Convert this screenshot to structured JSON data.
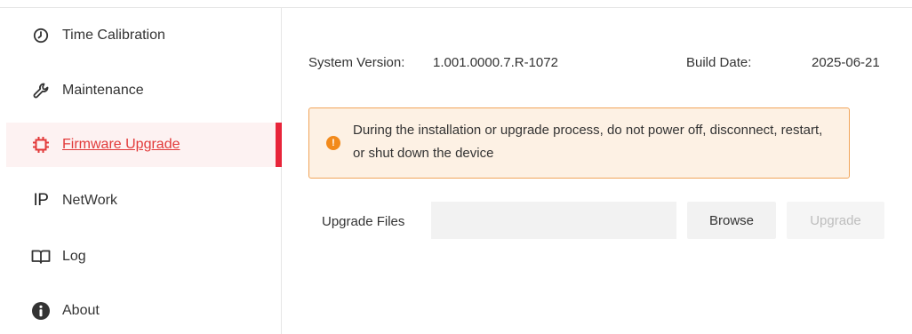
{
  "sidebar": {
    "items": [
      {
        "label": "Time Calibration",
        "icon": "clock-icon",
        "active": false
      },
      {
        "label": "Maintenance",
        "icon": "wrench-icon",
        "active": false
      },
      {
        "label": "Firmware Upgrade",
        "icon": "chip-icon",
        "active": true
      },
      {
        "label": "NetWork",
        "icon": "ip-icon",
        "icon_text": "IP",
        "active": false
      },
      {
        "label": "Log",
        "icon": "book-icon",
        "active": false
      },
      {
        "label": "About",
        "icon": "info-icon",
        "active": false
      }
    ]
  },
  "main": {
    "system_version_label": "System Version:",
    "system_version_value": "1.001.0000.7.R-1072",
    "build_date_label": "Build Date:",
    "build_date_value": "2025-06-21",
    "alert": {
      "icon": "warning-icon",
      "icon_glyph": "!",
      "message": "During the installation or upgrade process, do not power off, disconnect, restart, or shut down the device"
    },
    "upgrade_files_label": "Upgrade Files",
    "upgrade_files_value": "",
    "browse_label": "Browse",
    "upgrade_label": "Upgrade",
    "upgrade_disabled": true
  },
  "colors": {
    "accent": "#e8253a",
    "active_bg": "#fdf2f2",
    "alert_bg": "#fdf1e4",
    "alert_border": "#f1a55a",
    "warning_icon": "#f28a1b"
  }
}
